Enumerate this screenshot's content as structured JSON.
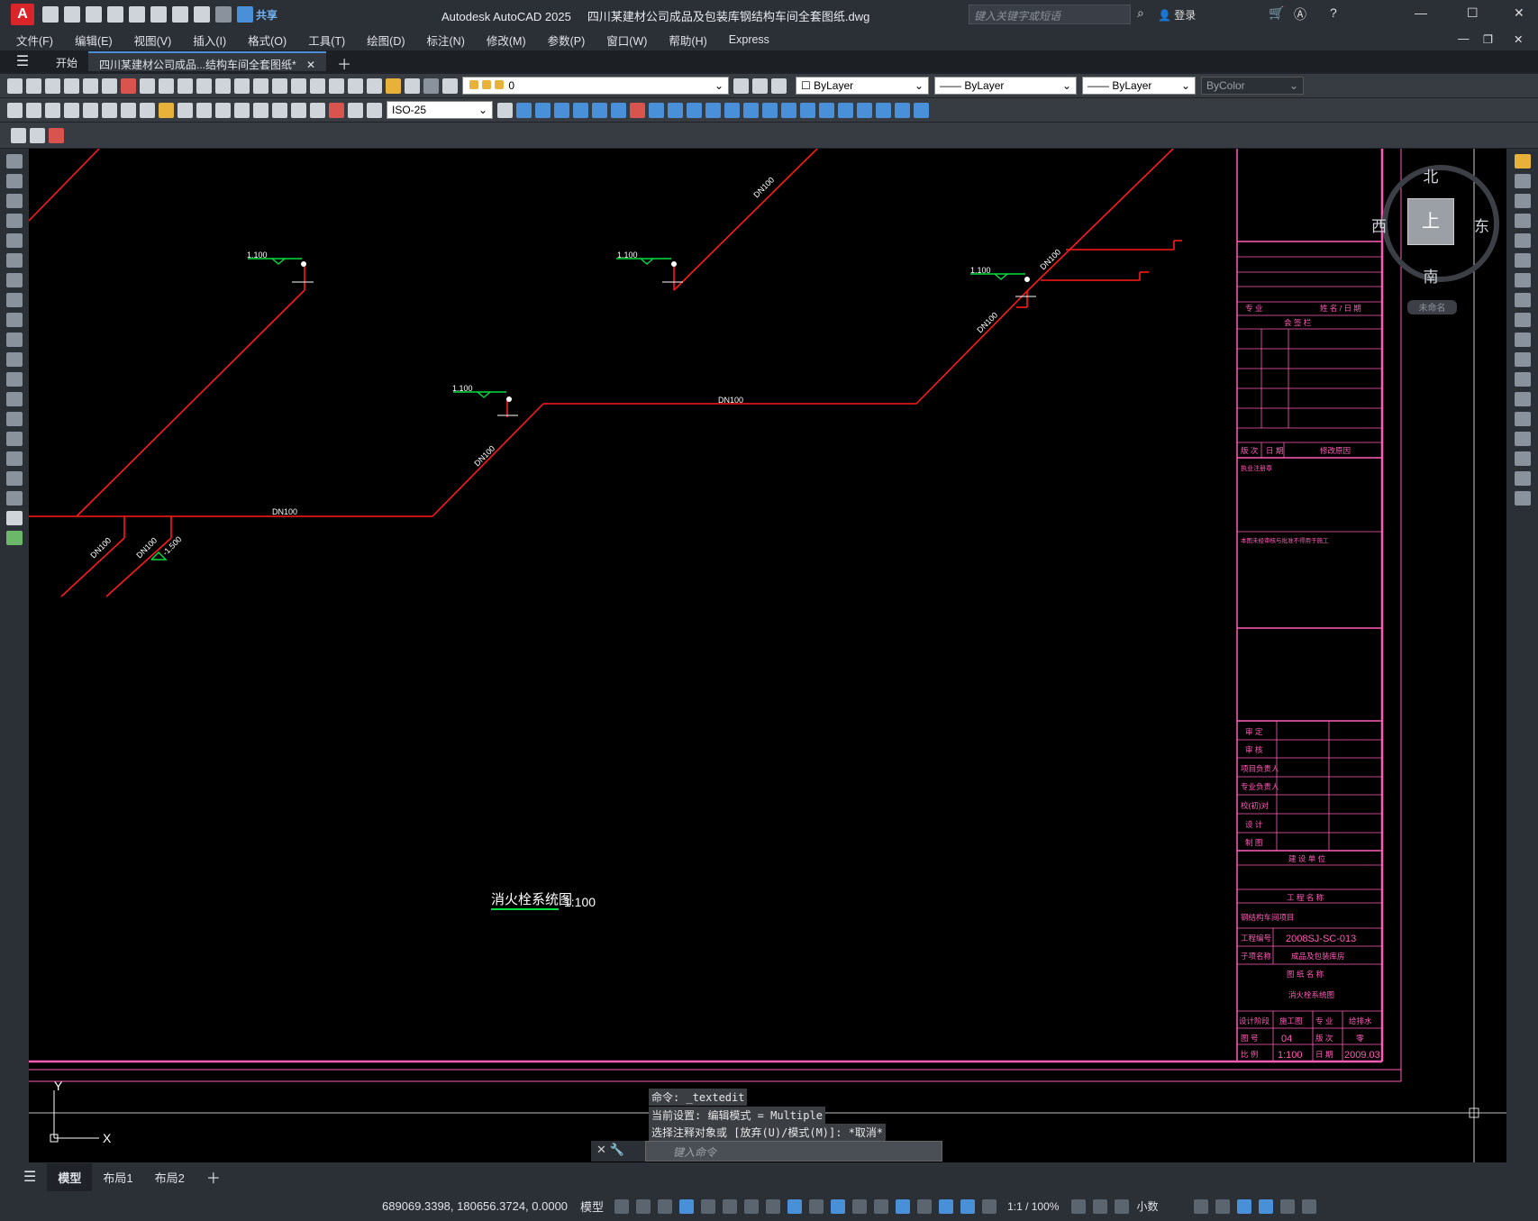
{
  "app": {
    "title": "Autodesk AutoCAD 2025",
    "document": "四川某建材公司成品及包装库钢结构车间全套图纸.dwg",
    "search_placeholder": "键入关键字或短语",
    "login": "登录",
    "share": "共享"
  },
  "menu": [
    "文件(F)",
    "编辑(E)",
    "视图(V)",
    "插入(I)",
    "格式(O)",
    "工具(T)",
    "绘图(D)",
    "标注(N)",
    "修改(M)",
    "参数(P)",
    "窗口(W)",
    "帮助(H)",
    "Express"
  ],
  "doc_tabs": {
    "start": "开始",
    "active": "四川某建材公司成品...结构车间全套图纸*"
  },
  "toolbar": {
    "layer_current": "0",
    "color": "ByLayer",
    "linetype": "ByLayer",
    "lineweight": "ByLayer",
    "plotstyle": "ByColor",
    "dimstyle": "ISO-25"
  },
  "viewcube": {
    "north": "北",
    "south": "南",
    "east": "东",
    "west": "西",
    "top": "上",
    "wcs": "未命名"
  },
  "drawing": {
    "pipe_label": "DN100",
    "elevation": "1.100",
    "elevation_low": "-1.500",
    "title": "消火栓系统图",
    "scale": "1:100"
  },
  "titleblock": {
    "header": "专 业",
    "sign_date": "姓 名 / 日 期",
    "countersign": "会 签 栏",
    "revision": [
      "版 次",
      "日 期",
      "修改原因"
    ],
    "approval_note": "执业注册章",
    "note": "本图未经审核与批准不得用于施工",
    "roles": [
      "审 定",
      "审 核",
      "项目负责人",
      "专业负责人",
      "校(初)对",
      "设 计",
      "制 图"
    ],
    "unit": "建 设 单 位",
    "project_name_label": "工 程 名 称",
    "project_name": "钢结构车间项目",
    "project_no_label": "工程编号",
    "project_no": "2008SJ-SC-013",
    "sub_label": "子项名称",
    "sub_name": "成品及包装库房",
    "drawing_name_label": "图 纸 名 称",
    "drawing_name": "消火栓系统图",
    "stage_label": "设计阶段",
    "stage": "施工图",
    "discipline_label": "专 业",
    "discipline": "给排水",
    "sheet_label": "图 号",
    "sheet": "04",
    "version_label": "版 次",
    "version": "零",
    "scale_label": "比 例",
    "scale": "1:100",
    "date_label": "日 期",
    "date": "2009.03"
  },
  "command": {
    "line1": "命令: _textedit",
    "line2": "当前设置: 编辑模式 = Multiple",
    "line3": "选择注释对象或 [放弃(U)/模式(M)]: *取消*",
    "placeholder": "键入命令"
  },
  "layouts": [
    "模型",
    "布局1",
    "布局2"
  ],
  "status": {
    "coords": "689069.3398, 180656.3724, 0.0000",
    "space": "模型",
    "annoscale": "1:1 / 100%",
    "units": "小数"
  },
  "ucs": {
    "x": "X",
    "y": "Y"
  }
}
